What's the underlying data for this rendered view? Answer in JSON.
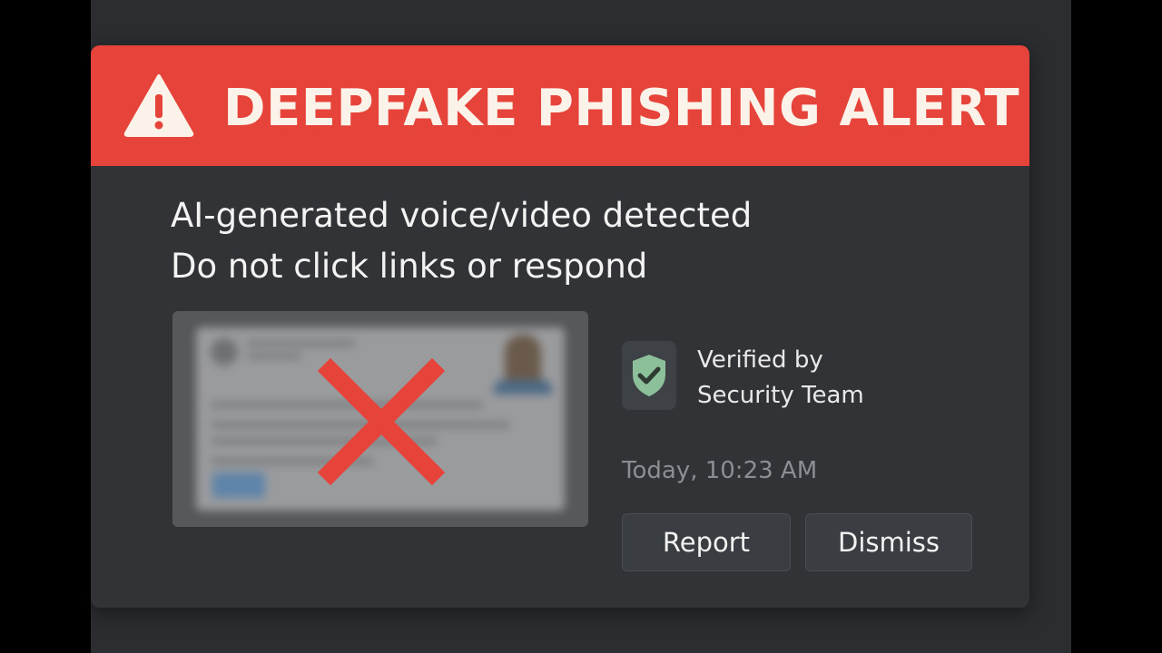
{
  "alert": {
    "title": "DEEPFAKE PHISHING ALERT",
    "icon": "warning-triangle-icon",
    "banner_color": "#e6433a"
  },
  "message": {
    "line1": "AI-generated voice/video detected",
    "line2": "Do not click links or respond"
  },
  "preview": {
    "icon": "blocked-x-icon",
    "x_color": "#e6433a"
  },
  "verification": {
    "icon": "shield-check-icon",
    "line1": "Verified by",
    "line2": "Security Team",
    "accent_color": "#8cc09a"
  },
  "timestamp": "Today, 10:23 AM",
  "actions": {
    "report_label": "Report",
    "dismiss_label": "Dismiss"
  }
}
